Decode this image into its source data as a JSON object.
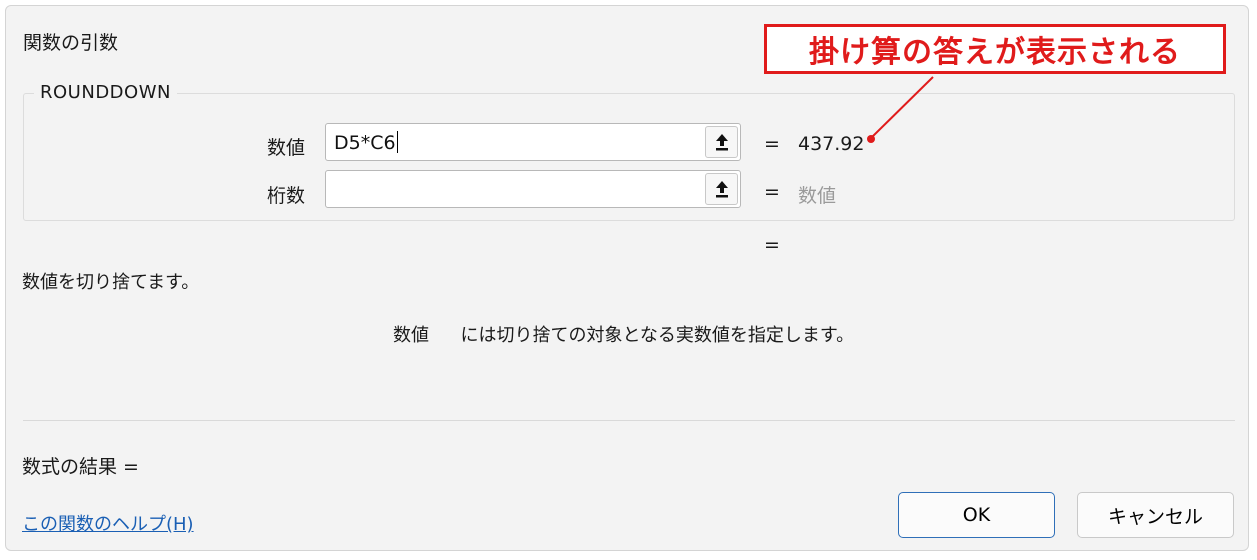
{
  "dialog": {
    "title": "関数の引数",
    "function_name": "ROUNDDOWN"
  },
  "args": [
    {
      "label": "数値",
      "value": "D5*C6",
      "equals": "=",
      "result": "437.92"
    },
    {
      "label": "桁数",
      "value": "",
      "equals": "=",
      "result": "数値"
    }
  ],
  "overall_equals": "=",
  "function_description": "数値を切り捨てます。",
  "arg_description": {
    "name": "数値",
    "text": "には切り捨ての対象となる実数値を指定します。"
  },
  "formula_result_label": "数式の結果 =",
  "help_link": "この関数のヘルプ(H)",
  "buttons": {
    "ok": "OK",
    "cancel": "キャンセル"
  },
  "callout": {
    "text": "掛け算の答えが表示される"
  },
  "colors": {
    "callout_red": "#e01b1b",
    "link_blue": "#1a5fb4",
    "dialog_bg": "#f3f3f3"
  },
  "icons": {
    "ref_button": "collapse-dialog-arrow-up-icon"
  }
}
